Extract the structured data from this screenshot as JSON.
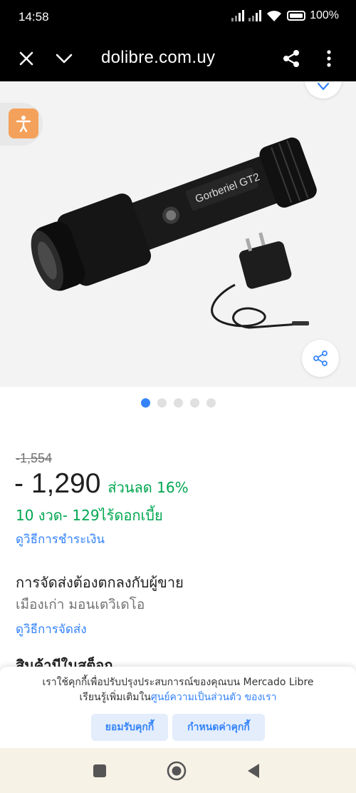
{
  "status_bar": {
    "time": "14:58",
    "battery": "100%",
    "icons": [
      "signal-icon",
      "signal-icon",
      "wifi-icon",
      "battery-icon"
    ]
  },
  "browser": {
    "url": "dolibre.com.uy",
    "icons": [
      "close-icon",
      "chevron-down-icon",
      "share-icon",
      "more-vert-icon"
    ]
  },
  "gallery": {
    "image_alt": "flashlight-with-charger",
    "brand_on_product": "Gorberiel GT2",
    "page_count": 5,
    "current_page": 1,
    "icons": [
      "heart-icon",
      "accessibility-icon",
      "share-icon"
    ]
  },
  "product": {
    "old_price": "-1,554",
    "price": "- 1,290",
    "discount": "ส่วนลด 16%",
    "installments": "10 งวด- 129ไร้ดอกเบี้ย",
    "payment_link": "ดูวิธีการชำระเงิน",
    "shipping_title": "การจัดส่งต้องตกลงกับผู้ขาย",
    "shipping_location": "เมืองเก่า มอนเตวิเดโอ",
    "shipping_link": "ดูวิธีการจัดส่ง",
    "stock_title": "สินค้ามีในสต็อก"
  },
  "cookie_banner": {
    "line1": "เราใช้คุกกี้เพื่อปรับปรุงประสบการณ์ของคุณบน Mercado Libre",
    "line2_prefix": "เรียนรู้เพิ่มเติมใน",
    "policy_link": "ศูนย์ความเป็นส่วนตัว ของเรา",
    "accept_label": "ยอมรับคุกกี้",
    "settings_label": "กำหนดค่าคุกกี้"
  },
  "colors": {
    "accent": "#3483fa",
    "green": "#00a650",
    "dot_active": "#3483fa",
    "dot_inactive": "#e0e0e0"
  },
  "navbar": {
    "icons": [
      "recents-square-icon",
      "home-circle-icon",
      "back-triangle-icon"
    ]
  }
}
